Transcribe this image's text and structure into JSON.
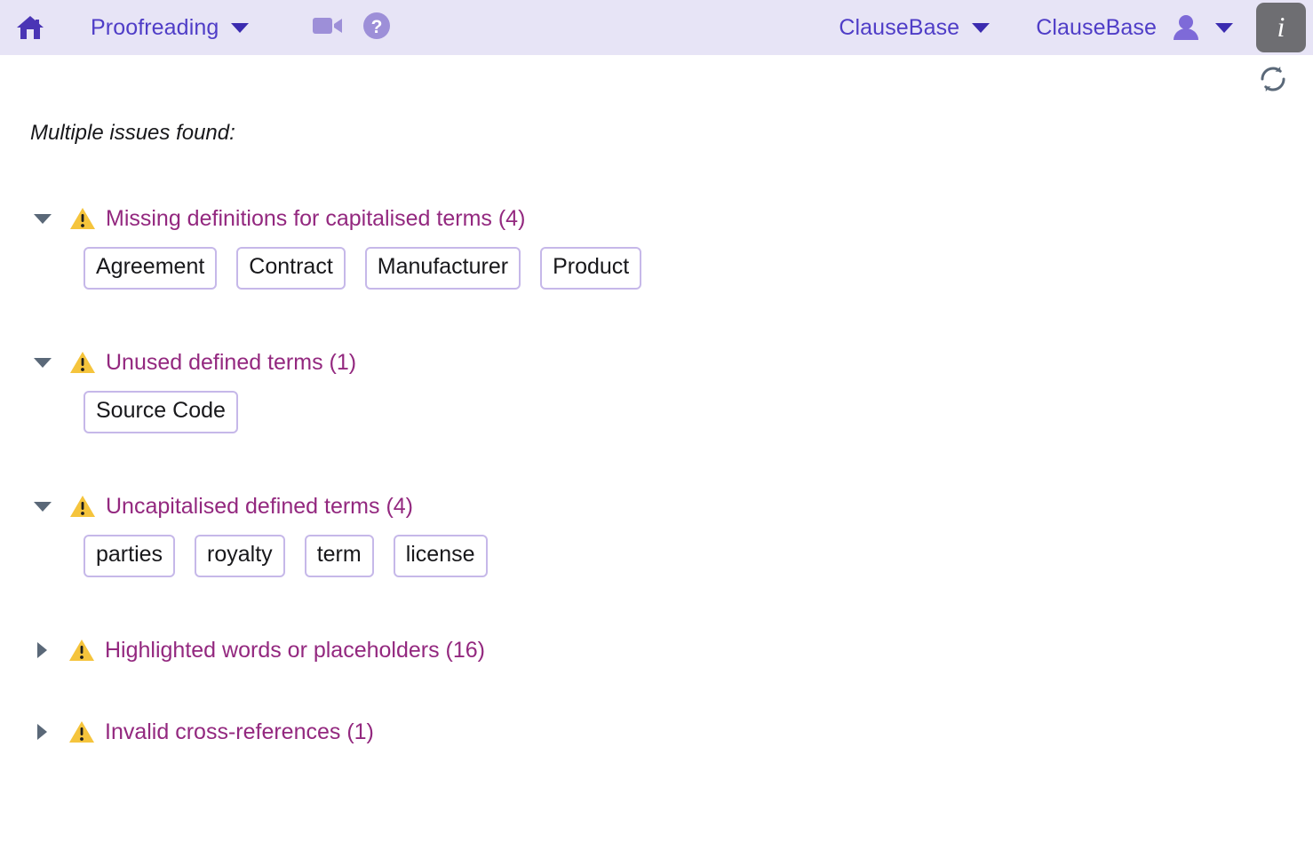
{
  "header": {
    "home_icon": "home-icon",
    "module_menu": {
      "label": "Proofreading",
      "caret_icon": "chevron-down-icon"
    },
    "video_icon": "video-camera-icon",
    "help_icon": "help-circle-icon",
    "workspace_menu": {
      "label": "ClauseBase",
      "caret_icon": "chevron-down-icon"
    },
    "account_menu": {
      "label": "ClauseBase",
      "user_icon": "user-icon",
      "caret_icon": "chevron-down-icon"
    },
    "info_button": {
      "label": "i",
      "icon": "info-icon"
    },
    "colors": {
      "bar_background": "#e7e4f6",
      "primary_text": "#4f3dc7",
      "home_icon": "#4a35b5",
      "muted_icon": "#9d8fd8",
      "info_button_bg": "#6e6e72"
    }
  },
  "toolbar": {
    "refresh_icon": "refresh-icon",
    "refresh_color": "#5a6878"
  },
  "results": {
    "heading": "Multiple issues found:",
    "warning_icon": "warning-triangle-icon",
    "warning_color": "#f5c43c",
    "title_color": "#93287f",
    "chip_border_color": "#c6b8e9",
    "twisty_color": "#5a6878",
    "groups": [
      {
        "title": "Missing definitions for capitalised terms (4)",
        "count": 4,
        "expanded": true,
        "twisty_icon": "triangle-down-icon",
        "items": [
          "Agreement",
          "Contract",
          "Manufacturer",
          "Product"
        ]
      },
      {
        "title": "Unused defined terms (1)",
        "count": 1,
        "expanded": true,
        "twisty_icon": "triangle-down-icon",
        "items": [
          "Source Code"
        ]
      },
      {
        "title": "Uncapitalised defined terms (4)",
        "count": 4,
        "expanded": true,
        "twisty_icon": "triangle-down-icon",
        "items": [
          "parties",
          "royalty",
          "term",
          "license"
        ]
      },
      {
        "title": "Highlighted words or placeholders (16)",
        "count": 16,
        "expanded": false,
        "twisty_icon": "triangle-right-icon",
        "items": []
      },
      {
        "title": "Invalid cross-references (1)",
        "count": 1,
        "expanded": false,
        "twisty_icon": "triangle-right-icon",
        "items": []
      }
    ]
  }
}
